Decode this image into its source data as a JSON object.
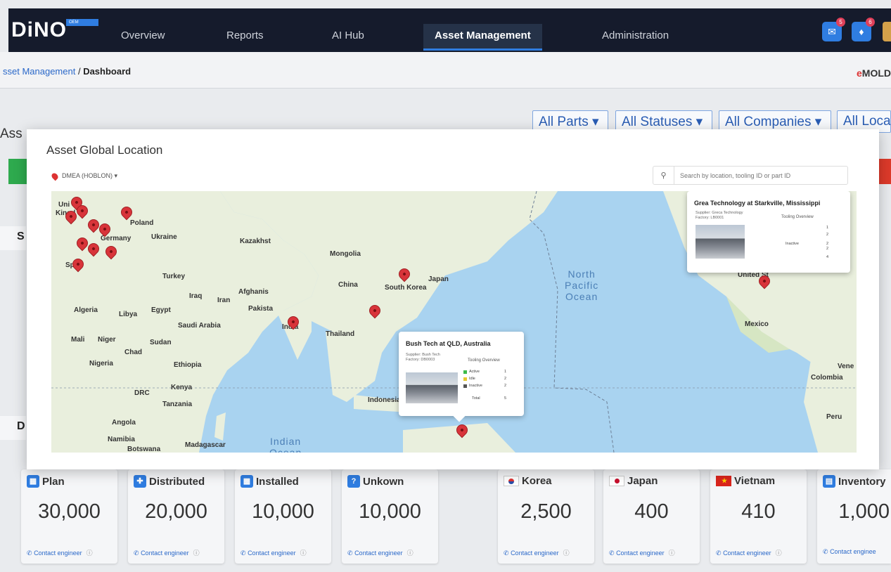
{
  "app": {
    "logo": "DiNO",
    "logo_badge": "OEM"
  },
  "nav": {
    "items": [
      {
        "label": "Overview"
      },
      {
        "label": "Reports"
      },
      {
        "label": "AI Hub"
      },
      {
        "label": "Asset Management"
      },
      {
        "label": "Administration"
      }
    ],
    "active": "Asset Management",
    "notifications": [
      {
        "icon": "chat-icon",
        "count": "5"
      },
      {
        "icon": "bell-icon",
        "count": "6"
      }
    ]
  },
  "breadcrumb": {
    "parent": "sset Management",
    "separator": " / ",
    "current": "Dashboard"
  },
  "brand": {
    "prefix": "e",
    "name": "MOLD"
  },
  "filters": [
    "All Parts",
    "All Statuses",
    "All Companies",
    "All Locat"
  ],
  "background_labels": {
    "asset_partial": "Ass",
    "section_s": "S",
    "section_d": "D"
  },
  "modal": {
    "title": "Asset Global Location",
    "location_filter": "DMEA (HOBLON) ▾",
    "search_placeholder": "Search by location, tooling ID or part ID"
  },
  "map": {
    "labels": [
      "Uni",
      "Kingd",
      "Poland",
      "Ukraine",
      "Germany",
      "Spa",
      "Kazakhst",
      "Mongolia",
      "China",
      "South Korea",
      "Japan",
      "Turkey",
      "Iraq",
      "Iran",
      "Afghanis",
      "Pakista",
      "India",
      "Saudi Arabia",
      "Egypt",
      "Libya",
      "Algeria",
      "Mali",
      "Niger",
      "Chad",
      "Sudan",
      "Nigeria",
      "Ethiopia",
      "Kenya",
      "DRC",
      "Tanzania",
      "Angola",
      "Namibia",
      "Botswana",
      "Madagascar",
      "Thailand",
      "Indonesia",
      "United St",
      "Mexico",
      "Colombia",
      "Vene",
      "Peru"
    ],
    "oceans": {
      "north_pacific": "North\nPacific\nOcean",
      "indian": "Indian\nOcean"
    },
    "marker_count": 17,
    "popup_us": {
      "title": "Grea Technology at Starkville, Mississippi",
      "supplier": "Supplier: Greca Technology",
      "factory": "Factory: LB0001",
      "tooling_title": "Tooling Overview",
      "rows": [
        {
          "label": "",
          "value": "1"
        },
        {
          "label": "",
          "value": "2"
        },
        {
          "label": "Inactive",
          "value": "2"
        },
        {
          "label": "",
          "value": "2"
        },
        {
          "label": "",
          "value": "4"
        }
      ]
    },
    "popup_au": {
      "title": "Bush Tech at QLD, Australia",
      "supplier": "Supplier: Bush Tech",
      "factory": "Factory: DB0003",
      "tooling_title": "Tooling Overview",
      "rows": [
        {
          "label": "Active",
          "value": "1",
          "color": "#3dbb4a"
        },
        {
          "label": "Idle",
          "value": "2",
          "color": "#e6c830"
        },
        {
          "label": "Inactive",
          "value": "2",
          "color": "#555555"
        },
        {
          "label": "Total",
          "value": "5",
          "color": ""
        }
      ]
    }
  },
  "cards": [
    {
      "label": "Plan",
      "value": "30,000",
      "icon": "calendar-icon",
      "foot": "Contact engineer"
    },
    {
      "label": "Distributed",
      "value": "20,000",
      "icon": "distribute-icon",
      "foot": "Contact engineer"
    },
    {
      "label": "Installed",
      "value": "10,000",
      "icon": "install-icon",
      "foot": "Contact engineer"
    },
    {
      "label": "Unkown",
      "value": "10,000",
      "icon": "question-icon",
      "foot": "Contact engineer"
    },
    {
      "label": "Korea",
      "value": "2,500",
      "icon": "korea-flag-icon",
      "foot": "Contact engineer"
    },
    {
      "label": "Japan",
      "value": "400",
      "icon": "japan-flag-icon",
      "foot": "Contact engineer"
    },
    {
      "label": "Vietnam",
      "value": "410",
      "icon": "vietnam-flag-icon",
      "foot": "Contact engineer"
    },
    {
      "label": "Inventory",
      "value": "1,000",
      "icon": "inventory-icon",
      "foot": "Contact enginee"
    }
  ],
  "colors": {
    "nav_bg": "#151b2c",
    "accent": "#2f7de1",
    "map_water": "#a9d3f0",
    "map_land": "#e9efdd",
    "marker": "#d8343a"
  }
}
